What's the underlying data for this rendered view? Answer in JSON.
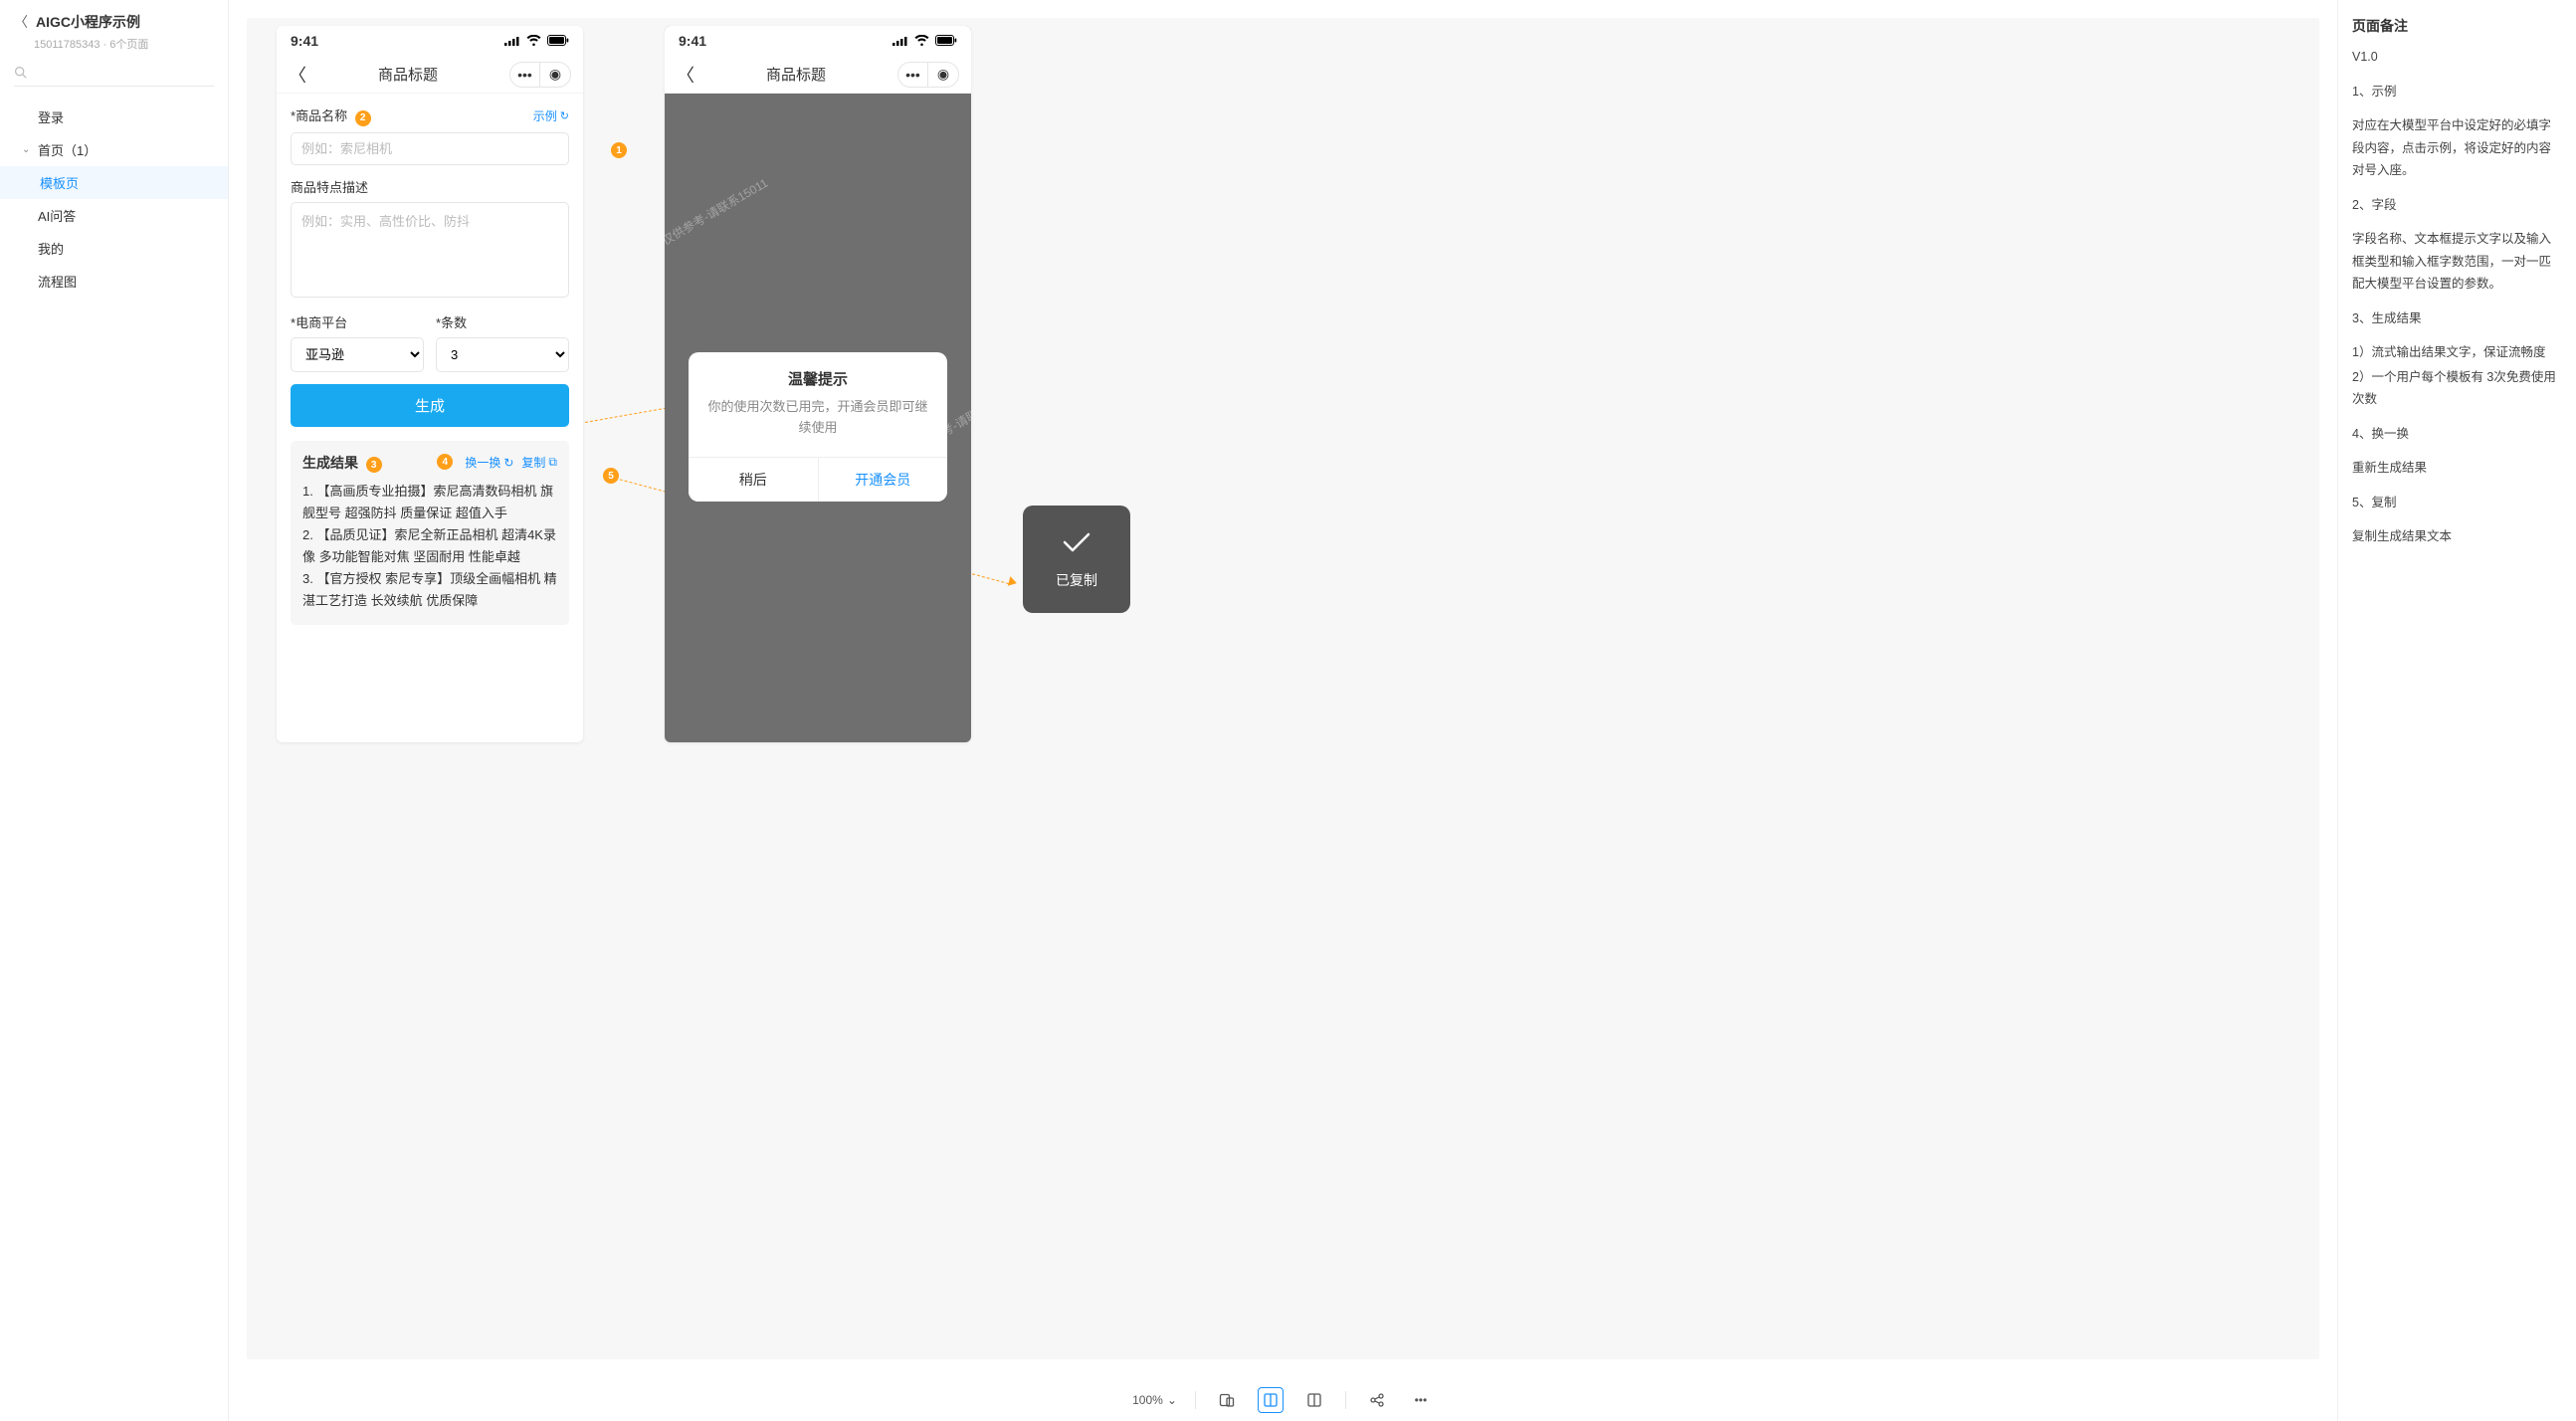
{
  "sidebar": {
    "back_aria": "back",
    "title": "AIGC小程序示例",
    "subtitle": "15011785343 · 6个页面",
    "search_placeholder": "",
    "items": [
      {
        "label": "登录",
        "level": 1,
        "active": false
      },
      {
        "label": "首页（1）",
        "level": 1,
        "active": false,
        "expanded": true
      },
      {
        "label": "模板页",
        "level": 2,
        "active": true
      },
      {
        "label": "AI问答",
        "level": 1,
        "active": false
      },
      {
        "label": "我的",
        "level": 1,
        "active": false
      },
      {
        "label": "流程图",
        "level": 1,
        "active": false
      }
    ]
  },
  "phone1": {
    "time": "9:41",
    "nav_title": "商品标题",
    "field_name_label": "商品名称",
    "example_link": "示例",
    "field_name_placeholder": "例如：索尼相机",
    "field_desc_label": "商品特点描述",
    "field_desc_placeholder": "例如：实用、高性价比、防抖",
    "field_platform_label": "电商平台",
    "field_platform_value": "亚马逊",
    "field_count_label": "条数",
    "field_count_value": "3",
    "generate_btn": "生成",
    "result_title": "生成结果",
    "action_regen": "换一换",
    "action_copy": "复制",
    "result_lines": [
      "1. 【高画质专业拍摄】索尼高清数码相机 旗舰型号 超强防抖 质量保证 超值入手",
      "2. 【品质见证】索尼全新正品相机 超清4K录像 多功能智能对焦 坚固耐用 性能卓越",
      "3. 【官方授权 索尼专享】顶级全画幅相机 精湛工艺打造 长效续航 优质保障"
    ]
  },
  "phone2": {
    "time": "9:41",
    "nav_title": "商品标题",
    "watermark": "仅供参考-请联系15011",
    "dialog_title": "温馨提示",
    "dialog_body": "你的使用次数已用完，开通会员即可继续使用",
    "btn_later": "稍后",
    "btn_open": "开通会员"
  },
  "toast": {
    "text": "已复制"
  },
  "annotations": {
    "1": "1",
    "2": "2",
    "3": "3",
    "4": "4",
    "5": "5"
  },
  "toolbar": {
    "zoom": "100%"
  },
  "notes": {
    "heading": "页面备注",
    "version": "V1.0",
    "p1_title": "1、示例",
    "p1_body": "对应在大模型平台中设定好的必填字段内容，点击示例，将设定好的内容对号入座。",
    "p2_title": "2、字段",
    "p2_body": "字段名称、文本框提示文字以及输入框类型和输入框字数范围，一对一匹配大模型平台设置的参数。",
    "p3_title": "3、生成结果",
    "p3_l1": "1）流式输出结果文字，保证流畅度",
    "p3_l2": "2）一个用户每个模板有 3次免费使用次数",
    "p4_title": "4、换一换",
    "p4_body": "重新生成结果",
    "p5_title": "5、复制",
    "p5_body": "复制生成结果文本"
  }
}
